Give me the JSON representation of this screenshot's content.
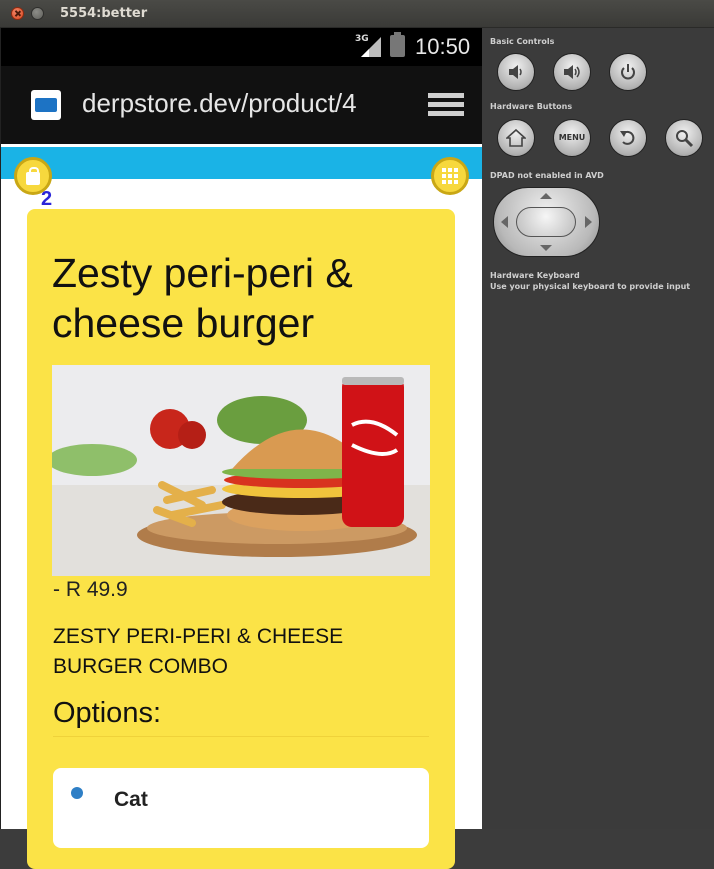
{
  "window": {
    "title": "5554:better"
  },
  "status_bar": {
    "network": "3G",
    "time": "10:50"
  },
  "browser": {
    "url": "derpstore.dev/product/4"
  },
  "cart": {
    "count": "2"
  },
  "product": {
    "title": "Zesty peri-peri & cheese burger",
    "price": "- R 49.9",
    "description": "ZESTY PERI-PERI & CHEESE BURGER COMBO",
    "options_heading": "Options:",
    "options": [
      {
        "label": "Cat",
        "selected": true
      }
    ]
  },
  "emulator_panel": {
    "basic_controls_heading": "Basic Controls",
    "hardware_buttons_heading": "Hardware Buttons",
    "menu_label": "MENU",
    "dpad_heading": "DPAD not enabled in AVD",
    "keyboard_heading": "Hardware Keyboard",
    "keyboard_note": "Use your physical keyboard to provide input"
  },
  "colors": {
    "accent_blue": "#1ab3e6",
    "card_yellow": "#fbe347",
    "cart_count": "#2a25d9"
  }
}
